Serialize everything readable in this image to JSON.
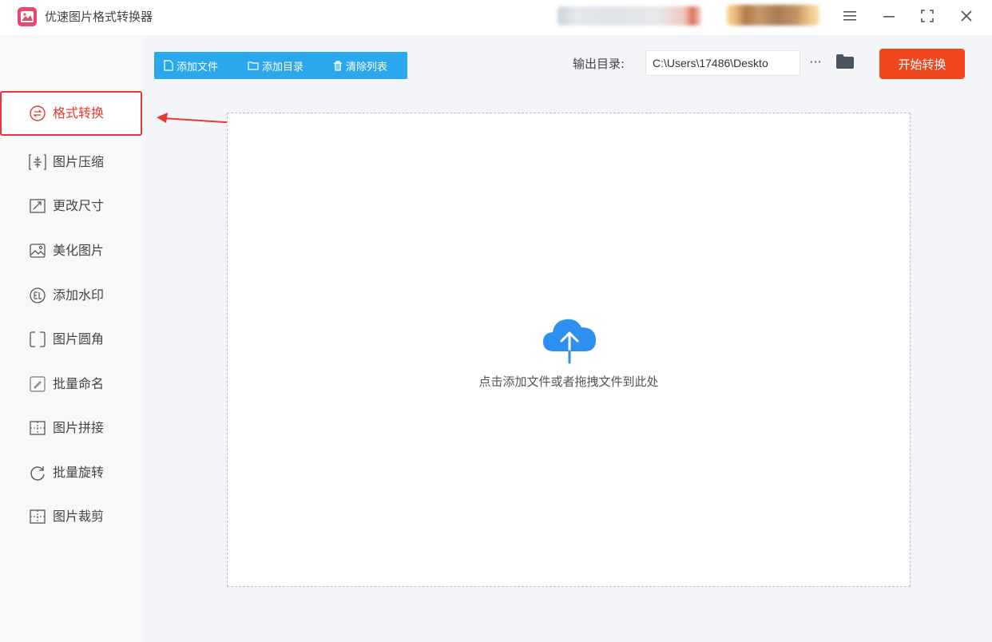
{
  "app": {
    "title": "优速图片格式转换器",
    "accent_color": "#2aa8ee",
    "start_color": "#f0471f",
    "highlight_color": "#e53935"
  },
  "window_controls": {
    "menu_icon": "menu-icon",
    "minimize_icon": "minimize-icon",
    "maximize_icon": "maximize-icon",
    "close_icon": "close-icon"
  },
  "sidebar": {
    "items": [
      {
        "label": "格式转换",
        "icon": "format-convert-icon",
        "active": true
      },
      {
        "label": "图片压缩",
        "icon": "compress-icon"
      },
      {
        "label": "更改尺寸",
        "icon": "resize-icon"
      },
      {
        "label": "美化图片",
        "icon": "beautify-icon"
      },
      {
        "label": "添加水印",
        "icon": "watermark-icon"
      },
      {
        "label": "图片圆角",
        "icon": "round-corner-icon"
      },
      {
        "label": "批量命名",
        "icon": "rename-icon"
      },
      {
        "label": "图片拼接",
        "icon": "stitch-icon"
      },
      {
        "label": "批量旋转",
        "icon": "rotate-icon"
      },
      {
        "label": "图片裁剪",
        "icon": "crop-icon"
      }
    ]
  },
  "toolbar": {
    "add_file": "添加文件",
    "add_folder": "添加目录",
    "clear_list": "清除列表"
  },
  "output": {
    "label": "输出目录:",
    "path": "C:\\Users\\17486\\Deskto",
    "more": "···"
  },
  "start_button": "开始转换",
  "dropzone": {
    "text": "点击添加文件或者拖拽文件到此处"
  }
}
